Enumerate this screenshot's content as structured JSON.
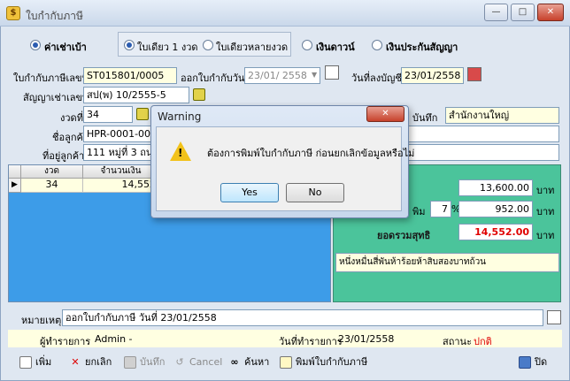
{
  "window": {
    "title": "ใบกำกับภาษี",
    "app_icon_glyph": "$",
    "min_glyph": "—",
    "max_glyph": "□",
    "close_glyph": "✕"
  },
  "mode_options": {
    "rental": "ค่าเช่าเบ้า",
    "single": "ใบเดียว 1 งวด",
    "multi": "ใบเดียวหลายงวด",
    "down": "เงินดาวน์",
    "insurance": "เงินประกันสัญญา"
  },
  "form": {
    "invoice_no_label": "ใบกำกับภาษีเลขที่",
    "invoice_no": "ST015801/0005",
    "issue_date_label": "ออกใบกำกับวันที่",
    "issue_date": "23/01/ 2558",
    "account_date_label": "วันที่ลงบัญชี",
    "account_date": "23/01/2558",
    "contract_label": "สัญญาเช่าเลขที่",
    "contract_no": "สป(พ) 10/2555-5",
    "installment_label": "งวดที่",
    "installment": "34",
    "record_label": "บันทึก",
    "branch": "สำนักงานใหญ่",
    "customer_label": "ชื่อลูกค้า",
    "customer_code": "HPR-0001-00082",
    "address_label": "ที่อยู่ลูกค้า",
    "address": "111 หมู่ที่ 3 ถนนเ"
  },
  "grid": {
    "columns": [
      "งวด",
      "จำนวนเงิน"
    ],
    "rows": [
      {
        "period": "34",
        "amount": "14,552"
      }
    ]
  },
  "summary": {
    "amount": "13,600.00",
    "unit": "บาท",
    "vat_label": "พิม",
    "vat_rate": "7",
    "percent": "%",
    "vat_amount": "952.00",
    "total_label": "ยอดรวมสุทธิ",
    "total": "14,552.00",
    "amount_text": "หนึ่งหมื่นสี่พันห้าร้อยห้าสิบสองบาทถ้วน"
  },
  "remark": {
    "label": "หมายเหตุ",
    "value": "ออกใบกำกับภาษี วันที่ 23/01/2558"
  },
  "status_bar": {
    "operator_label": "ผู้ทำรายการ",
    "operator": "Admin -",
    "txn_date_label": "วันที่ทำรายการ",
    "txn_date": "23/01/2558",
    "status_label": "สถานะ",
    "status": "ปกติ"
  },
  "toolbar": {
    "add": "เพิ่ม",
    "cancel_doc": "ยกเลิก",
    "save": "บันทึก",
    "cancel": "Cancel",
    "search": "ค้นหา",
    "print": "พิมพ์ใบกำกับภาษี",
    "close": "ปิด"
  },
  "dialog": {
    "title": "Warning",
    "message": "ต้องการพิมพ์ใบกำกับภาษี ก่อนยกเลิกข้อมูลหรือไม่",
    "yes": "Yes",
    "no": "No",
    "close_glyph": "✕",
    "warning_glyph": "!"
  },
  "colors": {
    "accent_blue": "#3d9ce8",
    "summary_green": "#4bc49b",
    "total_red": "#e00000"
  }
}
